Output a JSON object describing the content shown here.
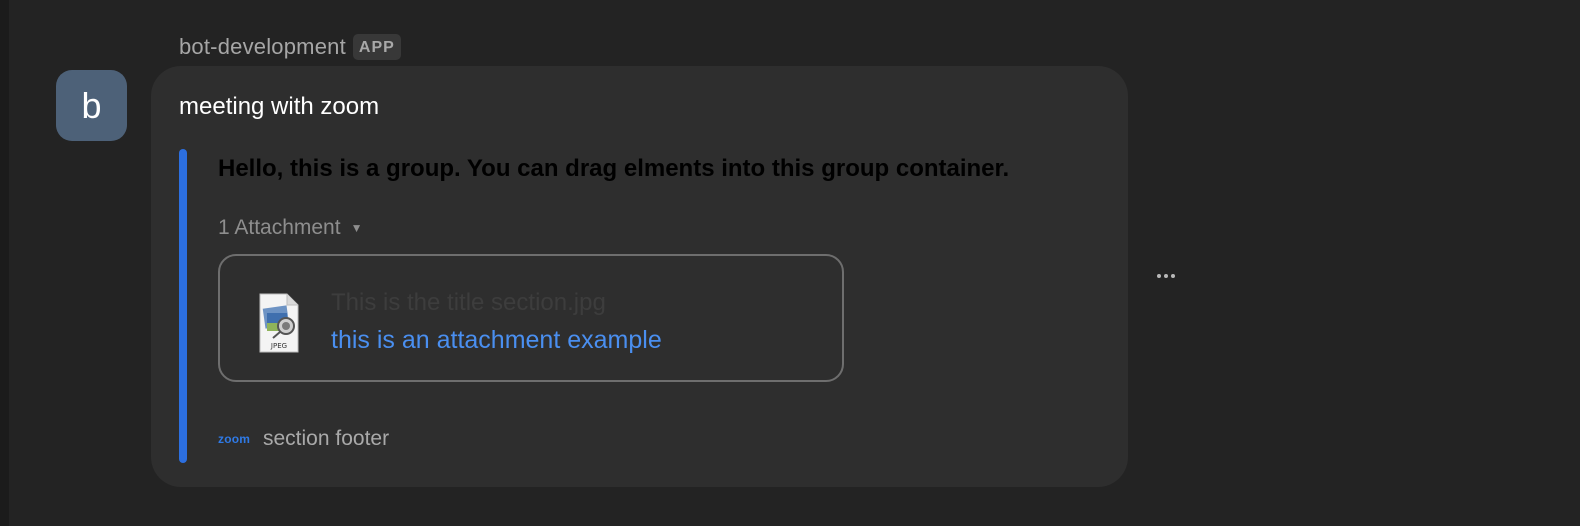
{
  "message": {
    "sender_name": "bot-development",
    "sender_badge": "APP",
    "avatar_letter": "b",
    "text": "meeting with zoom",
    "section": {
      "header": "Hello, this is a group. You can drag elments into this group container.",
      "attachment_toggle_label": "1 Attachment",
      "attachment": {
        "title": "This is the title section.jpg",
        "link_text": "this is an attachment example",
        "file_type_label": "JPEG",
        "icon": "jpeg-file-icon"
      },
      "footer": {
        "logo_text": "zoom",
        "text": "section footer"
      }
    },
    "more_icon": "more-options-icon"
  },
  "colors": {
    "background": "#232323",
    "bubble": "#2e2e2e",
    "accent_bar": "#2c6fe0",
    "link": "#4a8ff0",
    "avatar": "#4d6178"
  }
}
